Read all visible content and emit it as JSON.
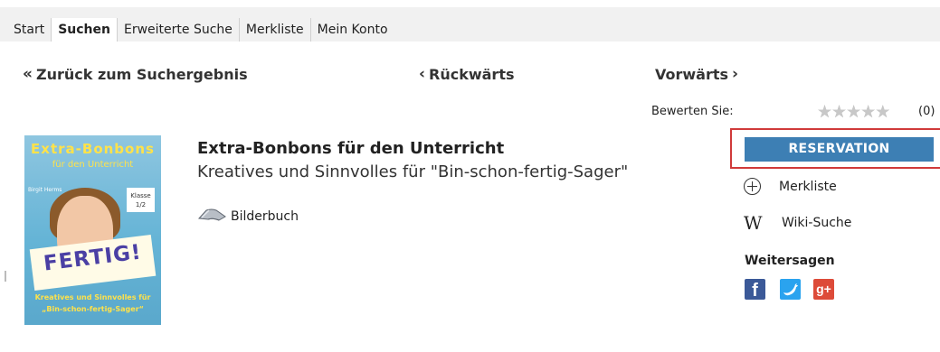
{
  "tabs": [
    {
      "label": "Start",
      "active": false
    },
    {
      "label": "Suchen",
      "active": true
    },
    {
      "label": "Erweiterte Suche",
      "active": false
    },
    {
      "label": "Merkliste",
      "active": false
    },
    {
      "label": "Mein Konto",
      "active": false
    }
  ],
  "nav": {
    "back_to_results": {
      "icon": "double-chevron-left-icon",
      "glyph": "«",
      "label": "Zurück zum Suchergebnis"
    },
    "previous": {
      "icon": "chevron-left-icon",
      "glyph": "‹",
      "label": "Rückwärts"
    },
    "next": {
      "icon": "chevron-right-icon",
      "glyph": "›",
      "label": "Vorwärts"
    }
  },
  "rating": {
    "label": "Bewerten Sie:",
    "stars": 5,
    "selected": 0,
    "star_glyph": "★",
    "count_text": "(0)"
  },
  "record": {
    "title": "Extra-Bonbons für den Unterricht",
    "subtitle": "Kreatives und Sinnvolles für \"Bin-schon-fertig-Sager\"",
    "media_type": "Bilderbuch",
    "media_icon": "book-icon",
    "cover": {
      "title": "Extra-Bonbons",
      "subtitle": "für den Unterricht",
      "author": "Birgit Herms",
      "badge_line1": "Klasse",
      "badge_line2": "1/2",
      "sign_text": "FERTIG!",
      "bottom_line1": "Kreatives und Sinnvolles für",
      "bottom_line2": "„Bin-schon-fertig-Sager“"
    }
  },
  "actions": {
    "reservation_label": "RESERVATION",
    "merkliste": {
      "icon": "plus-circle-icon",
      "label": "Merkliste"
    },
    "wiki": {
      "icon": "wikipedia-icon",
      "glyph": "W",
      "label": "Wiki-Suche"
    }
  },
  "share": {
    "title": "Weitersagen",
    "networks": [
      {
        "name": "facebook",
        "icon": "facebook-icon",
        "glyph": "f",
        "color": "#3b5998"
      },
      {
        "name": "twitter",
        "icon": "twitter-icon",
        "glyph": "🐦",
        "color": "#2aa3ef"
      },
      {
        "name": "google-plus",
        "icon": "google-plus-icon",
        "glyph": "g+",
        "color": "#dd4b39"
      }
    ]
  },
  "colors": {
    "tabbar_bg": "#f1f1f1",
    "reserve_button": "#3d7fb4",
    "highlight_border": "#d03a3a"
  }
}
